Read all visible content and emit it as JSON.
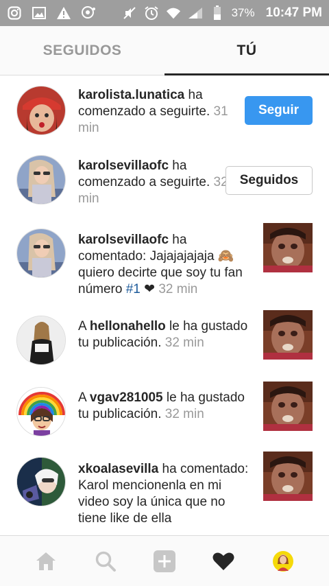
{
  "status_bar": {
    "battery": "37%",
    "time": "10:47 PM"
  },
  "tabs": [
    {
      "label": "SEGUIDOS",
      "active": false
    },
    {
      "label": "TÚ",
      "active": true
    }
  ],
  "notifications": [
    {
      "prefix": "",
      "user": "karolista.lunatica",
      "message": " ha comenzado a seguirte. ",
      "time": "31 min",
      "button": "Seguir"
    },
    {
      "prefix": "",
      "user": "karolsevillaofc",
      "message": " ha comenzado a seguirte. ",
      "time": "32 min",
      "button": "Seguidos"
    },
    {
      "prefix": "",
      "user": "karolsevillaofc",
      "message": " ha comentado: Jajajajajaja 🙈 quiero decirte que soy tu fan número ",
      "tag": "#1",
      "after_tag": " ❤ ",
      "time": "32 min"
    },
    {
      "prefix": "A ",
      "user": "hellonahello",
      "message": " le ha gustado tu publicación. ",
      "time": "32 min"
    },
    {
      "prefix": "A ",
      "user": "vgav281005",
      "message": " le ha gustado tu publicación. ",
      "time": "32 min"
    },
    {
      "prefix": "",
      "user": "xkoalasevilla",
      "message": " ha comentado: Karol mencionenla en mi video soy la única que no tiene like de ella",
      "time": ""
    }
  ],
  "colors": {
    "status_bar": "#9e9e9e",
    "follow_button": "#3897f0",
    "hashtag": "#1c5a9a",
    "muted_text": "#999999"
  }
}
